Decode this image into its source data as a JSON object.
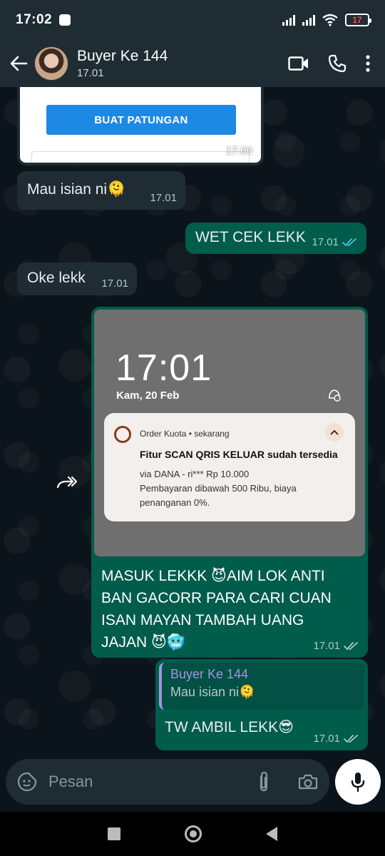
{
  "status_bar": {
    "time": "17:02",
    "battery": "17"
  },
  "header": {
    "contact_name": "Buyer Ke 144",
    "subtitle": "17.01"
  },
  "messages": {
    "card": {
      "button_label": "BUAT PATUNGAN",
      "time": "17.00"
    },
    "m1": {
      "text": "Mau isian ni🫠",
      "time": "17.01"
    },
    "m2": {
      "text": "WET CEK LEKK",
      "time": "17.01"
    },
    "m3": {
      "text": "Oke lekk",
      "time": "17.01"
    },
    "m4": {
      "screenshot": {
        "clock": "17:01",
        "date": "Kam, 20 Feb",
        "notif_app": "Order Kuota • sekarang",
        "notif_title": "Fitur SCAN QRIS KELUAR sudah tersedia",
        "notif_line1": "via DANA - ri*** Rp 10.000",
        "notif_line2": "Pembayaran dibawah 500 Ribu, biaya penanganan 0%."
      },
      "caption": "MASUK LEKKK 😈AIM LOK ANTI BAN GACORR PARA CARI CUAN ISAN MAYAN TAMBAH UANG JAJAN 😈🥶",
      "time": "17.01"
    },
    "m5": {
      "quote_name": "Buyer Ke 144",
      "quote_text": "Mau isian ni🫠",
      "text": "TW AMBIL LEKK😎",
      "time": "17.01"
    }
  },
  "input": {
    "placeholder": "Pesan"
  },
  "colors": {
    "outgoing": "#005c4b",
    "incoming": "#1f2c34",
    "read_tick": "#53bdeb",
    "accent_button": "#1e88e5"
  }
}
